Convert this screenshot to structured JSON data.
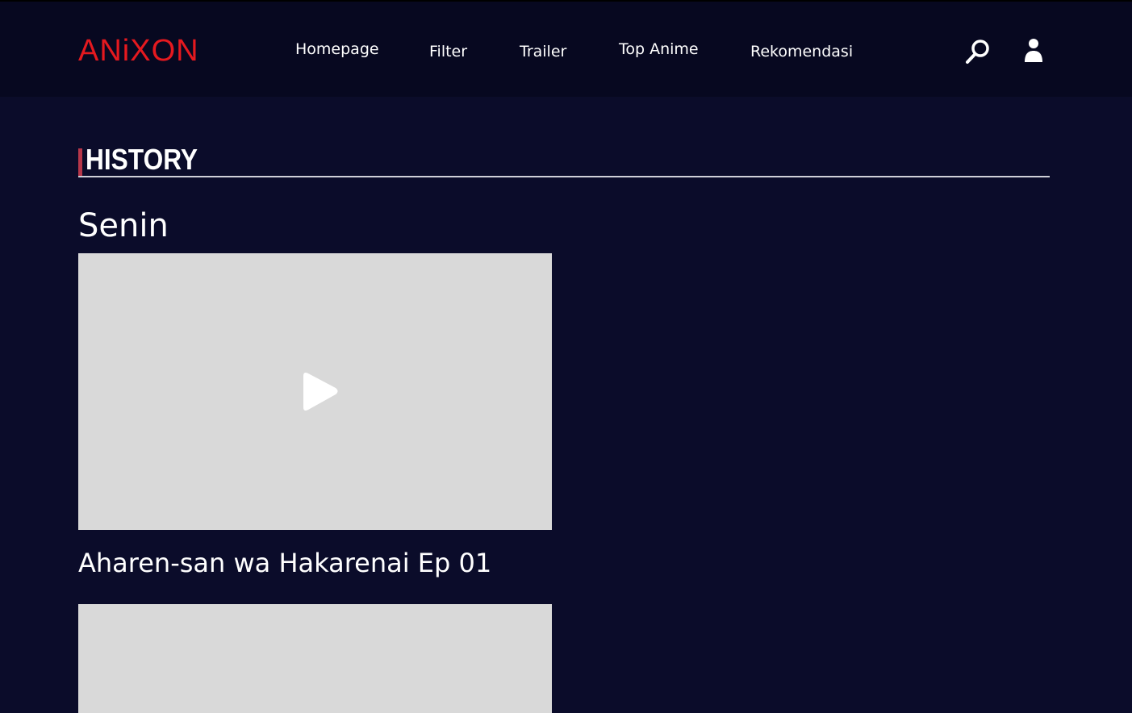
{
  "brand": {
    "logo_text": "ANiXON",
    "accent_color": "#e5191f"
  },
  "nav": {
    "items": [
      {
        "label": "Homepage"
      },
      {
        "label": "Filter"
      },
      {
        "label": "Trailer"
      },
      {
        "label": "Top Anime"
      },
      {
        "label": "Rekomendasi"
      }
    ],
    "icons": [
      "search-icon",
      "user-icon"
    ]
  },
  "page": {
    "section_title": "HISTORY",
    "section_accent_color": "#b7374a",
    "background_color": "#0b0c2a"
  },
  "history": {
    "groups": [
      {
        "day": "Senin",
        "entries": [
          {
            "title": "Aharen-san wa Hakarenai Ep 01",
            "thumbnail_icon": "play-icon"
          },
          {
            "title": "",
            "thumbnail_icon": ""
          }
        ]
      }
    ]
  }
}
